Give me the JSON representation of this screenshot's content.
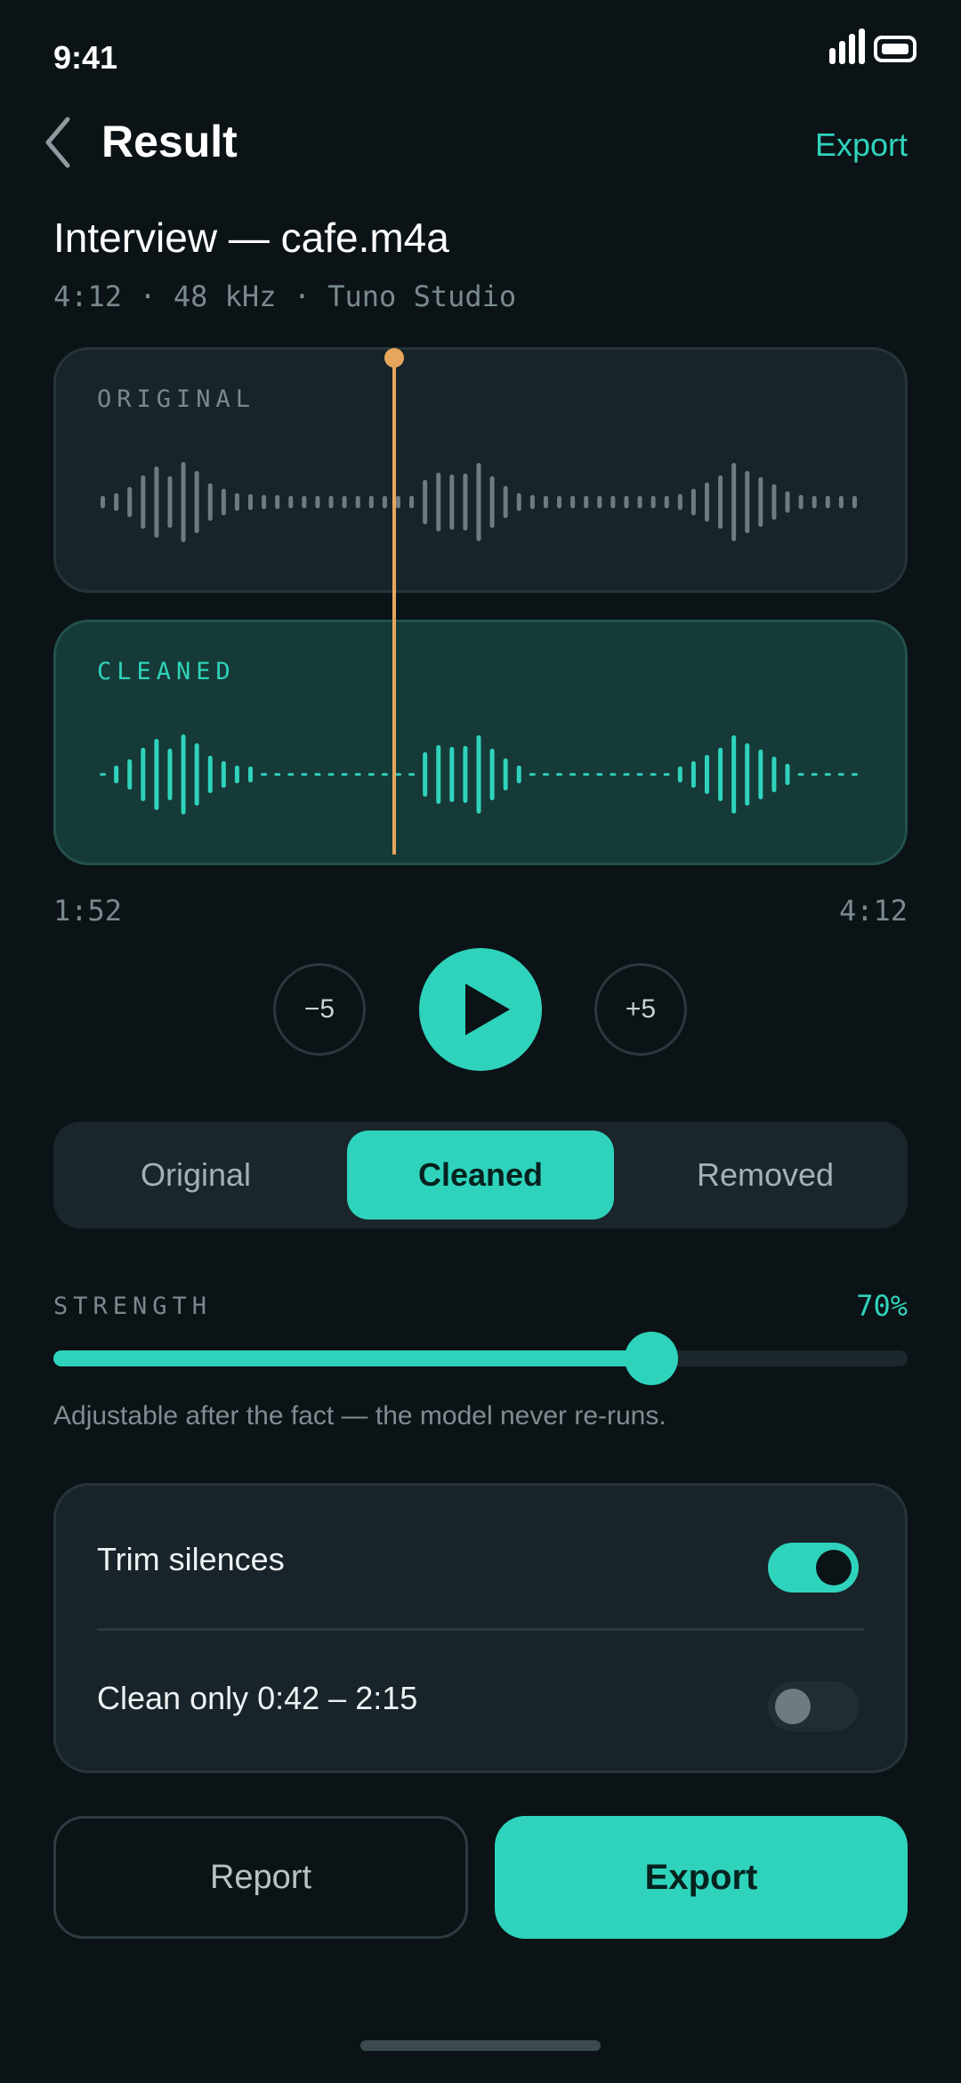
{
  "status_bar": {
    "time": "9:41"
  },
  "header": {
    "title": "Result",
    "export_label": "Export"
  },
  "file": {
    "name": "Interview — cafe.m4a",
    "meta": "4:12 · 48 kHz · Tuno Studio"
  },
  "waveforms": {
    "original_label": "ORIGINAL",
    "cleaned_label": "CLEANED",
    "playhead_fraction": 0.445
  },
  "timeline": {
    "current": "1:52",
    "total": "4:12"
  },
  "transport": {
    "skip_back_label": "−5",
    "skip_forward_label": "+5",
    "play_icon": "play-icon"
  },
  "mode_tabs": {
    "items": [
      {
        "label": "Original",
        "active": false
      },
      {
        "label": "Cleaned",
        "active": true
      },
      {
        "label": "Removed",
        "active": false
      }
    ]
  },
  "strength": {
    "label": "STRENGTH",
    "value_text": "70%",
    "value": 0.7,
    "hint": "Adjustable after the fact — the model never re-runs."
  },
  "options": {
    "trim_silences": {
      "label": "Trim silences",
      "on": true
    },
    "clean_range": {
      "label": "Clean only 0:42 – 2:15",
      "on": false
    }
  },
  "actions": {
    "report_label": "Report",
    "export_label": "Export"
  },
  "colors": {
    "accent": "#2fd3bc",
    "playhead": "#e6a65c",
    "background": "#0b1316",
    "original_wave": "#6f7b80"
  }
}
